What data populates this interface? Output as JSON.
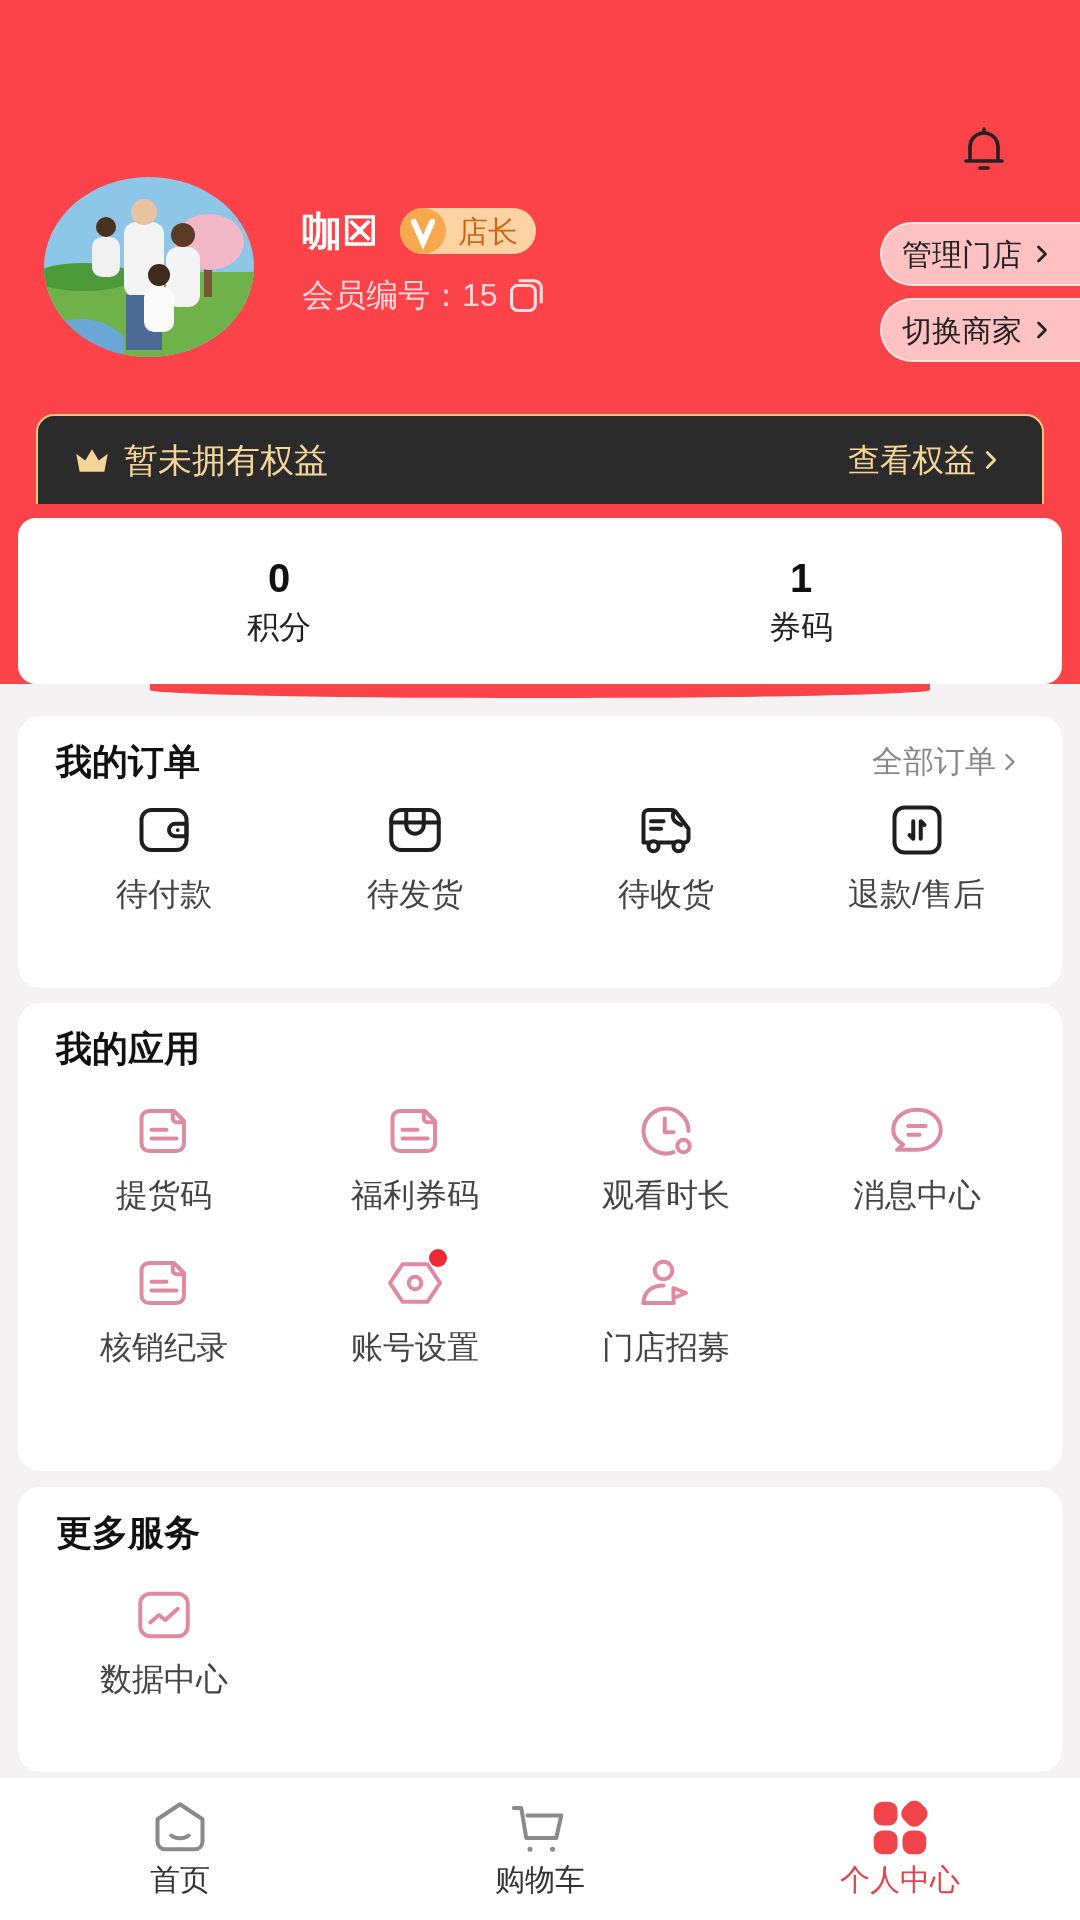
{
  "header": {
    "name": "咖☒",
    "badge": "店长",
    "member_id": "会员编号：15",
    "buttons": [
      "管理门店",
      "切换商家"
    ]
  },
  "benefits": {
    "text": "暂未拥有权益",
    "link": "查看权益"
  },
  "stats": [
    {
      "value": "0",
      "label": "积分"
    },
    {
      "value": "1",
      "label": "券码"
    }
  ],
  "orders": {
    "title": "我的订单",
    "link": "全部订单",
    "items": [
      {
        "label": "待付款",
        "kind": "wallet"
      },
      {
        "label": "待发货",
        "kind": "box"
      },
      {
        "label": "待收货",
        "kind": "truck"
      },
      {
        "label": "退款/售后",
        "kind": "refund"
      }
    ]
  },
  "apps": {
    "title": "我的应用",
    "items": [
      {
        "label": "提货码",
        "kind": "note",
        "dot": false
      },
      {
        "label": "福利券码",
        "kind": "note",
        "dot": false
      },
      {
        "label": "观看时长",
        "kind": "clock",
        "dot": false
      },
      {
        "label": "消息中心",
        "kind": "chat",
        "dot": false
      },
      {
        "label": "核销纪录",
        "kind": "note",
        "dot": false
      },
      {
        "label": "账号设置",
        "kind": "gear",
        "dot": true
      },
      {
        "label": "门店招募",
        "kind": "person",
        "dot": false
      }
    ]
  },
  "services": {
    "title": "更多服务",
    "items": [
      {
        "label": "数据中心",
        "kind": "chart"
      }
    ]
  },
  "tabbar": [
    {
      "label": "首页",
      "kind": "home",
      "selected": false
    },
    {
      "label": "购物车",
      "kind": "cart",
      "selected": false
    },
    {
      "label": "个人中心",
      "kind": "grid",
      "selected": true
    }
  ]
}
